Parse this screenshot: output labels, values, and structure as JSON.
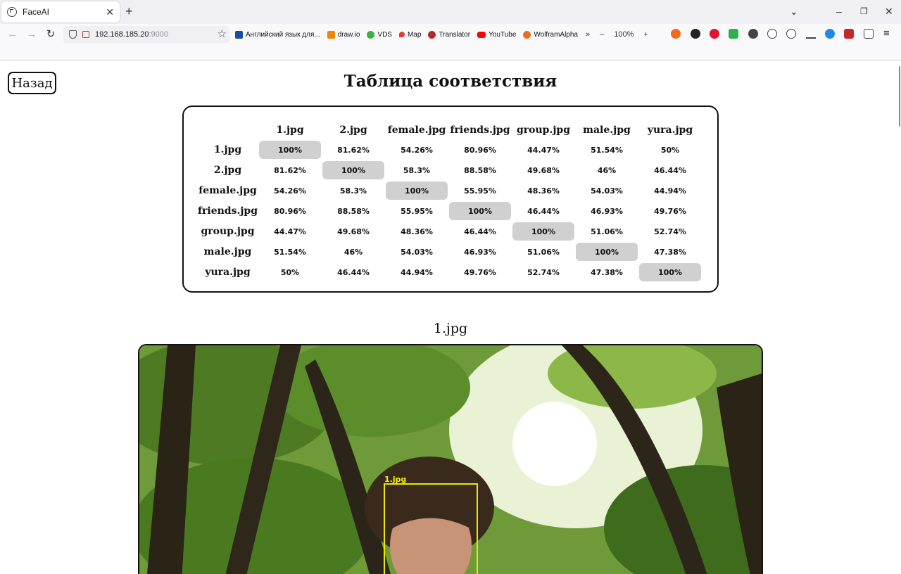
{
  "browser": {
    "tab_title": "FaceAI",
    "url_host": "192.168.185.20",
    "url_port": ":9000",
    "zoom_level": "100%",
    "bookmarks": [
      {
        "label": "Английский язык для...",
        "icon": "book-icon",
        "color": "#1a4fa0"
      },
      {
        "label": "draw.io",
        "icon": "drawio-icon",
        "color": "#f08705"
      },
      {
        "label": "VDS",
        "icon": "vds-icon",
        "color": "#3cb043"
      },
      {
        "label": "Map",
        "icon": "map-pin-icon",
        "color": "#e53935"
      },
      {
        "label": "Translator",
        "icon": "translator-icon",
        "color": "#b02a2a"
      },
      {
        "label": "YouTube",
        "icon": "youtube-icon",
        "color": "#ff0000"
      },
      {
        "label": "WolframAlpha",
        "icon": "wolfram-icon",
        "color": "#f26b1d"
      }
    ]
  },
  "page": {
    "back_label": "Назад",
    "title": "Таблица соответствия",
    "image_caption": "1.jpg",
    "face_label": "1.jpg"
  },
  "matrix": {
    "columns": [
      "1.jpg",
      "2.jpg",
      "female.jpg",
      "friends.jpg",
      "group.jpg",
      "male.jpg",
      "yura.jpg"
    ],
    "rows": [
      {
        "label": "1.jpg",
        "values": [
          "100%",
          "81.62%",
          "54.26%",
          "80.96%",
          "44.47%",
          "51.54%",
          "50%"
        ]
      },
      {
        "label": "2.jpg",
        "values": [
          "81.62%",
          "100%",
          "58.3%",
          "88.58%",
          "49.68%",
          "46%",
          "46.44%"
        ]
      },
      {
        "label": "female.jpg",
        "values": [
          "54.26%",
          "58.3%",
          "100%",
          "55.95%",
          "48.36%",
          "54.03%",
          "44.94%"
        ]
      },
      {
        "label": "friends.jpg",
        "values": [
          "80.96%",
          "88.58%",
          "55.95%",
          "100%",
          "46.44%",
          "46.93%",
          "49.76%"
        ]
      },
      {
        "label": "group.jpg",
        "values": [
          "44.47%",
          "49.68%",
          "48.36%",
          "46.44%",
          "100%",
          "51.06%",
          "52.74%"
        ]
      },
      {
        "label": "male.jpg",
        "values": [
          "51.54%",
          "46%",
          "54.03%",
          "46.93%",
          "51.06%",
          "100%",
          "47.38%"
        ]
      },
      {
        "label": "yura.jpg",
        "values": [
          "50%",
          "46.44%",
          "44.94%",
          "49.76%",
          "52.74%",
          "47.38%",
          "100%"
        ]
      }
    ]
  },
  "colors": {
    "diagonal_highlight": "#d0d0d0",
    "face_box": "#e8e800"
  }
}
